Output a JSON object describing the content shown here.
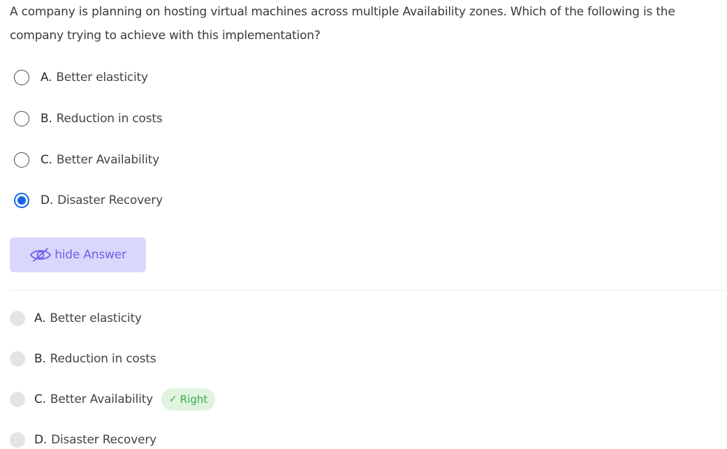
{
  "question": {
    "text": "A company is planning on hosting virtual machines across multiple Availability zones. Which of the following is the company trying to achieve with this implementation?"
  },
  "options": [
    {
      "letter": "A.",
      "text": "Better elasticity",
      "selected": false
    },
    {
      "letter": "B.",
      "text": "Reduction in costs",
      "selected": false
    },
    {
      "letter": "C.",
      "text": "Better Availability",
      "selected": false
    },
    {
      "letter": "D.",
      "text": "Disaster Recovery",
      "selected": true
    }
  ],
  "hide_button": {
    "label": "hide Answer",
    "icon": "eye-slash-icon"
  },
  "answers": [
    {
      "letter": "A.",
      "text": "Better elasticity"
    },
    {
      "letter": "B.",
      "text": "Reduction in costs"
    },
    {
      "letter": "C.",
      "text": "Better Availability",
      "badge": "Right"
    },
    {
      "letter": "D.",
      "text": "Disaster Recovery"
    }
  ],
  "colors": {
    "accent": "#1565e8",
    "button_bg": "#d9d7fb",
    "button_text": "#6c62e8",
    "badge_bg": "#dff3df",
    "badge_text": "#3caa48"
  }
}
